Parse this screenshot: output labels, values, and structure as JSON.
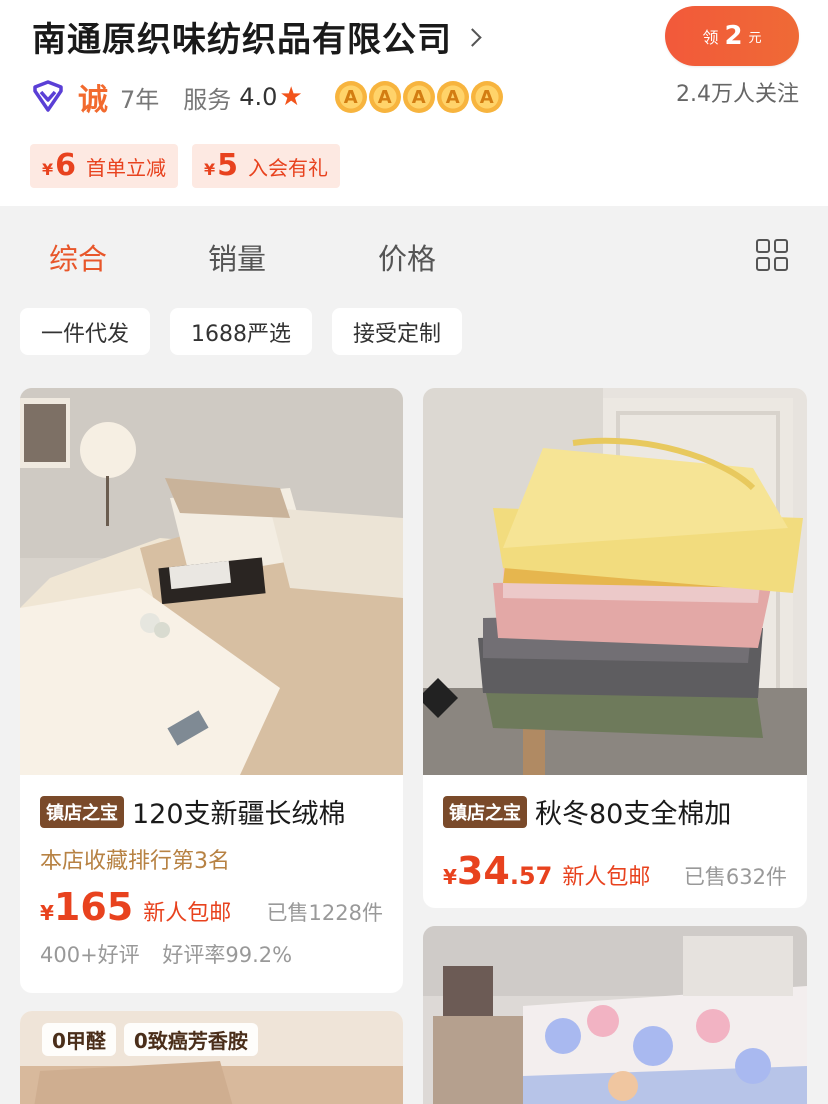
{
  "shop": {
    "name": "南通原织味纺织品有限公司",
    "integrity_mark": "诚",
    "years": "7年",
    "service_label": "服务",
    "service_score": "4.0",
    "rank_badges": [
      "A",
      "A",
      "A",
      "A",
      "A"
    ],
    "followers": "2.4万人关注"
  },
  "coupon_button": {
    "prefix": "领",
    "amount": "2",
    "unit": "元"
  },
  "coupons": [
    {
      "yen": "¥",
      "amount": "6",
      "text": "首单立减"
    },
    {
      "yen": "¥",
      "amount": "5",
      "text": "入会有礼"
    }
  ],
  "tabs": [
    {
      "label": "综合",
      "active": true
    },
    {
      "label": "销量",
      "active": false
    },
    {
      "label": "价格",
      "active": false
    }
  ],
  "filter_chips": [
    "一件代发",
    "1688严选",
    "接受定制"
  ],
  "products": [
    {
      "badge": "镇店之宝",
      "title": "120支新疆长绒棉",
      "rank": "本店收藏排行第3名",
      "yen": "¥",
      "price_int": "165",
      "price_dec": "",
      "promo": "新人包邮",
      "sold": "已售1228件",
      "reviews": "400+好评",
      "rating": "好评率99.2%"
    },
    {
      "badge": "镇店之宝",
      "title": "秋冬80支全棉加",
      "yen": "¥",
      "price_int": "34",
      "price_dec": ".57",
      "promo": "新人包邮",
      "sold": "已售632件"
    },
    {
      "feature_tags": [
        "0甲醛",
        "0致癌芳香胺"
      ]
    },
    {}
  ],
  "colors": {
    "accent": "#e8562a",
    "price": "#e8421e",
    "gold": "#b78243"
  }
}
